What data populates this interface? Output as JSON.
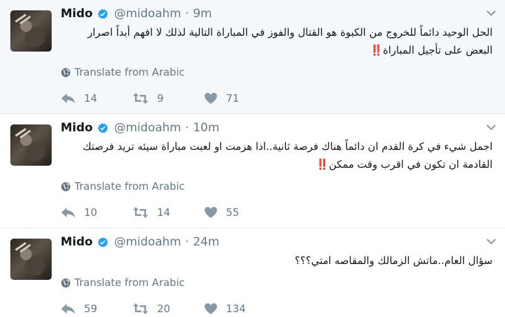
{
  "translate_label": "Translate from Arabic",
  "colors": {
    "meta_gray": "#657786",
    "verified_blue": "#1da1f2",
    "text_dark": "#14171a"
  },
  "icons": [
    "avatar",
    "verified-badge-icon",
    "caret-down-icon",
    "globe-icon",
    "reply-icon",
    "retweet-icon",
    "like-heart-icon"
  ],
  "tweets": [
    {
      "name": "Mido",
      "handle": "@midoahm",
      "separator": "·",
      "time": "9m",
      "text": "الحل الوحيد دائماً للخروج من الكبوة هو القتال والفوز في المباراة التالية لذلك لا افهم أبداً اصرار البعض على تأجيل المباراة‼️",
      "replies": "14",
      "retweets": "9",
      "likes": "71"
    },
    {
      "name": "Mido",
      "handle": "@midoahm",
      "separator": "·",
      "time": "10m",
      "text": "اجمل شيء في كرة القدم ان دائماً هناك فرصة ثانية..اذا هزمت او لعبت مباراة سيئه تريد فرصتك القادمة ان تكون في اقرب وقت ممكن‼️",
      "replies": "10",
      "retweets": "14",
      "likes": "55"
    },
    {
      "name": "Mido",
      "handle": "@midoahm",
      "separator": "·",
      "time": "24m",
      "text": "سؤال العام..ماتش الزمالك والمقاصه امتي؟؟؟",
      "replies": "59",
      "retweets": "20",
      "likes": "134"
    }
  ]
}
